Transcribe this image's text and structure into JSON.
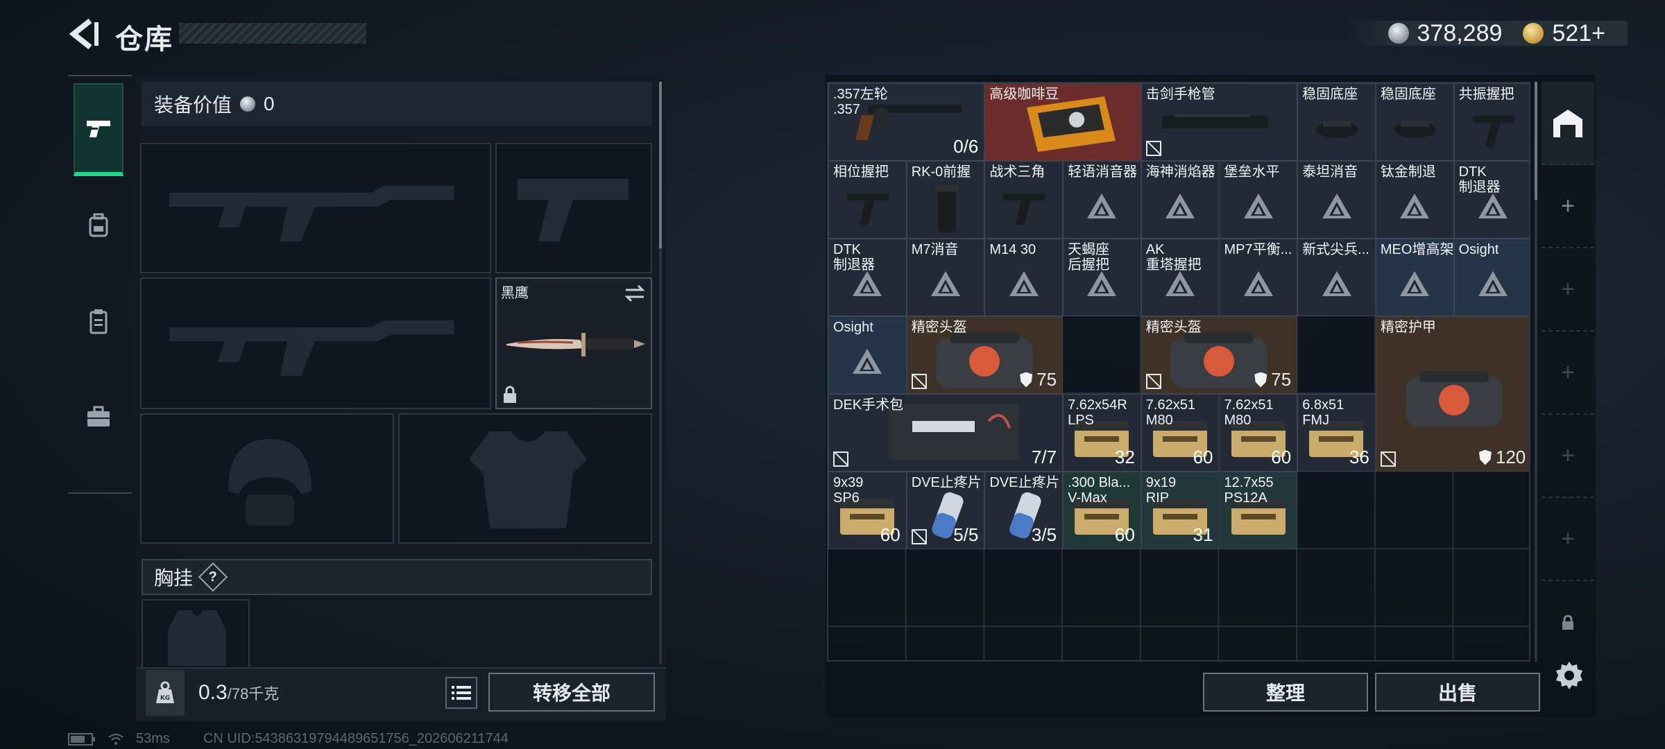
{
  "header": {
    "title": "仓库"
  },
  "currency": {
    "silver": "378,289",
    "gold": "521+"
  },
  "left": {
    "equip_label": "装备价值",
    "equip_value": "0",
    "knife_name": "黑鹰",
    "chest_label": "胸挂",
    "chest_help": "?",
    "weight": "0.3",
    "weight_max": "/78千克",
    "transfer_all": "转移全部"
  },
  "right": {
    "sort": "整理",
    "sell": "出售"
  },
  "status": {
    "ping": "53ms",
    "uid": "CN UID:54386319794489651756_202606211744"
  },
  "items": [
    {
      "name": ".357左轮\n.357",
      "count": "0/6",
      "color": "dark",
      "icon": "revolver-icon"
    },
    {
      "name": "高级咖啡豆",
      "color": "red",
      "icon": "coffee-bag-icon"
    },
    {
      "name": "击剑手枪管",
      "color": "dark",
      "icon": "barrel-icon",
      "not_tradable": true
    },
    {
      "name": "稳固底座",
      "color": "dark",
      "icon": "mount-icon"
    },
    {
      "name": "稳固底座",
      "color": "dark",
      "icon": "mount-icon"
    },
    {
      "name": "共振握把",
      "color": "dark",
      "icon": "grip-icon"
    },
    {
      "name": "相位握把",
      "color": "dark",
      "icon": "grip-icon"
    },
    {
      "name": "RK-0前握",
      "color": "dark",
      "icon": "foregrip-icon"
    },
    {
      "name": "战术三角",
      "color": "dark",
      "icon": "grip-icon"
    },
    {
      "name": "轻语消音器",
      "color": "dark",
      "icon": "placeholder-icon"
    },
    {
      "name": "海神消焰器",
      "color": "dark",
      "icon": "placeholder-icon"
    },
    {
      "name": "堡垒水平",
      "color": "dark",
      "icon": "placeholder-icon"
    },
    {
      "name": "泰坦消音",
      "color": "dark",
      "icon": "placeholder-icon"
    },
    {
      "name": "钛金制退",
      "color": "dark",
      "icon": "placeholder-icon"
    },
    {
      "name": "DTK\n制退器",
      "color": "dark",
      "icon": "placeholder-icon"
    },
    {
      "name": "DTK\n制退器",
      "color": "dark",
      "icon": "placeholder-icon"
    },
    {
      "name": "M7消音",
      "color": "dark",
      "icon": "placeholder-icon"
    },
    {
      "name": "M14 30",
      "color": "dark",
      "icon": "placeholder-icon"
    },
    {
      "name": "天蝎座\n后握把",
      "color": "dark",
      "icon": "placeholder-icon"
    },
    {
      "name": "AK\n重塔握把",
      "color": "dark",
      "icon": "placeholder-icon"
    },
    {
      "name": "MP7平衡...",
      "color": "dark",
      "icon": "placeholder-icon"
    },
    {
      "name": "新式尖兵...",
      "color": "dark",
      "icon": "placeholder-icon"
    },
    {
      "name": "MEO增高架",
      "color": "blue",
      "icon": "placeholder-icon"
    },
    {
      "name": "Osight",
      "color": "blue",
      "icon": "placeholder-icon"
    },
    {
      "name": "Osight",
      "color": "blue",
      "icon": "placeholder-icon"
    },
    {
      "name": "精密头盔",
      "color": "brown",
      "icon": "bag-icon",
      "defense": "75",
      "not_tradable": true
    },
    {
      "name": "精密头盔",
      "color": "brown",
      "icon": "bag-icon",
      "defense": "75",
      "not_tradable": true
    },
    {
      "name": "精密护甲",
      "color": "brown",
      "icon": "bag-icon",
      "defense": "120",
      "not_tradable": true
    },
    {
      "name": "DEK手术包",
      "count": "7/7",
      "color": "dark",
      "icon": "medkit-icon",
      "not_tradable": true
    },
    {
      "name": "7.62x54R\nLPS",
      "count": "32",
      "color": "dark",
      "icon": "ammo-box-icon"
    },
    {
      "name": "7.62x51\nM80",
      "count": "60",
      "color": "dark",
      "icon": "ammo-box-icon"
    },
    {
      "name": "7.62x51\nM80",
      "count": "60",
      "color": "dark",
      "icon": "ammo-box-icon"
    },
    {
      "name": "6.8x51\nFMJ",
      "count": "36",
      "color": "dark",
      "icon": "ammo-box-icon"
    },
    {
      "name": "9x39\nSP6",
      "count": "60",
      "color": "dark",
      "icon": "ammo-box-icon"
    },
    {
      "name": "DVE止疼片",
      "count": "5/5",
      "color": "dark",
      "icon": "pill-icon",
      "not_tradable": true
    },
    {
      "name": "DVE止疼片",
      "count": "3/5",
      "color": "dark",
      "icon": "pill-icon"
    },
    {
      "name": ".300 Bla...\nV-Max",
      "count": "60",
      "color": "green",
      "icon": "ammo-box-icon"
    },
    {
      "name": "9x19\nRIP",
      "count": "31",
      "color": "teal",
      "icon": "ammo-box-icon"
    },
    {
      "name": "12.7x55\nPS12A",
      "color": "teal",
      "icon": "ammo-box-icon"
    }
  ]
}
